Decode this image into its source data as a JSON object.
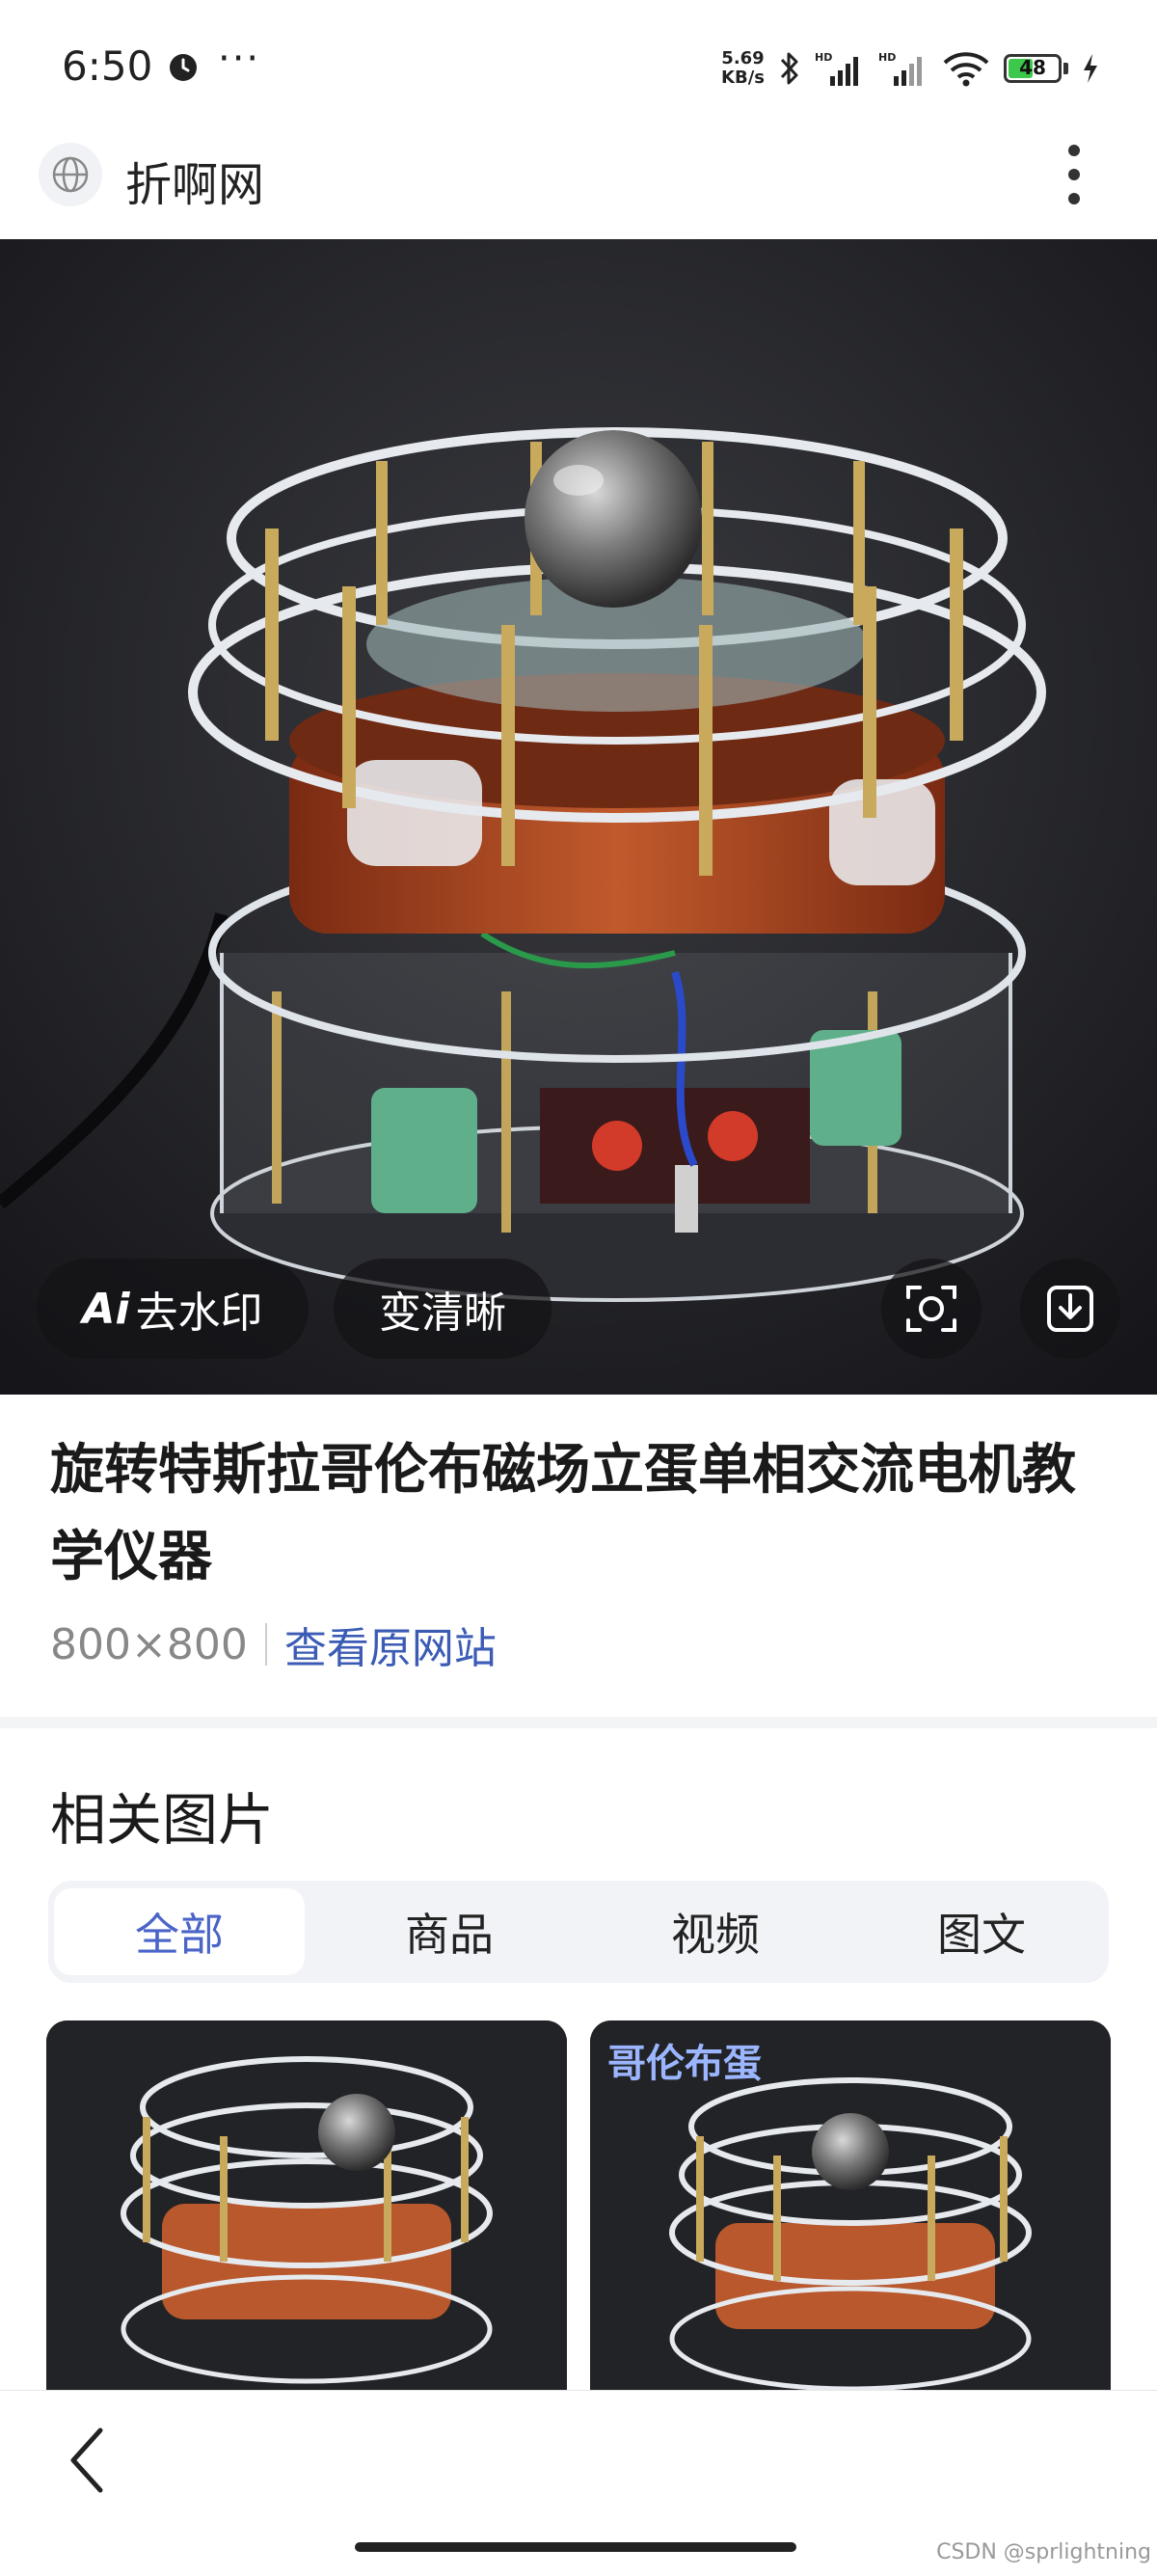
{
  "status_bar": {
    "time": "6:50",
    "more": "···",
    "net_speed_value": "5.69",
    "net_speed_unit": "KB/s",
    "battery_level": "48",
    "battery_fraction": 0.48,
    "icons": [
      "clock-icon",
      "bluetooth-icon",
      "hd-signal-icon",
      "hd-signal-icon",
      "wifi-icon",
      "battery-icon",
      "charging-icon"
    ]
  },
  "header": {
    "site_name": "折啊网",
    "icons": [
      "globe-icon",
      "more-vertical-icon"
    ]
  },
  "image_actions": {
    "remove_watermark_label": "去水印",
    "ai_badge": "Ai",
    "enhance_label": "变清晰",
    "icons": [
      "scan-icon",
      "download-icon"
    ]
  },
  "image_info": {
    "title": "旋转特斯拉哥伦布磁场立蛋单相交流电机教学仪器",
    "dimensions": "800×800",
    "source_link": "查看原网站"
  },
  "related": {
    "title": "相关图片",
    "tabs": [
      {
        "label": "全部",
        "active": true
      },
      {
        "label": "商品",
        "active": false
      },
      {
        "label": "视频",
        "active": false
      },
      {
        "label": "图文",
        "active": false
      }
    ],
    "thumb_right_label": "哥伦布蛋"
  },
  "footer": {
    "corner_watermark": "CSDN @sprlightning",
    "icons": [
      "back-icon"
    ]
  },
  "colors": {
    "accent": "#4a64c8",
    "link": "#3b5bb5",
    "battery_green": "#3cc84a"
  }
}
